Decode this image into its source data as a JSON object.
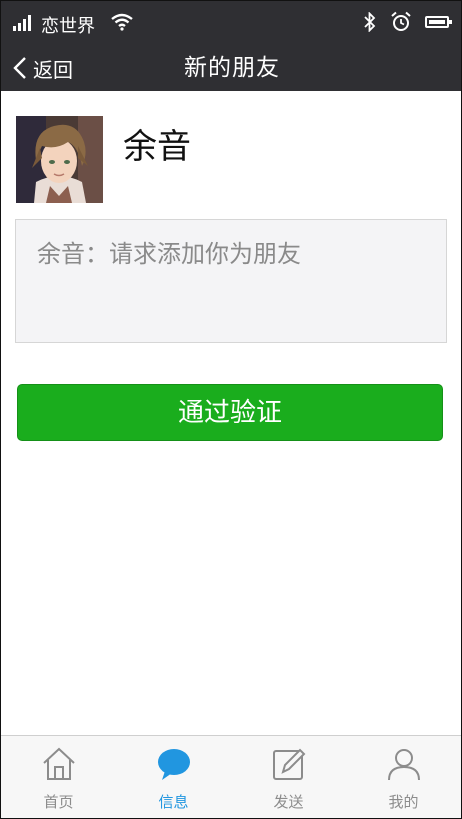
{
  "status_bar": {
    "carrier": "恋世界",
    "icons": [
      "signal-icon",
      "wifi-icon",
      "bluetooth-icon",
      "alarm-icon",
      "battery-icon"
    ]
  },
  "nav": {
    "back_label": "返回",
    "title": "新的朋友"
  },
  "request": {
    "name": "余音",
    "message": "余音：请求添加你为朋友"
  },
  "actions": {
    "verify_label": "通过验证"
  },
  "tabs": [
    {
      "label": "首页",
      "icon": "home-icon"
    },
    {
      "label": "信息",
      "icon": "chat-icon",
      "active": true
    },
    {
      "label": "发送",
      "icon": "compose-icon"
    },
    {
      "label": "我的",
      "icon": "user-icon"
    }
  ],
  "colors": {
    "bar": "#2f2f33",
    "accent_green": "#1aad1d",
    "active_tab": "#2196e0",
    "inactive_tab": "#8c8c8c"
  }
}
